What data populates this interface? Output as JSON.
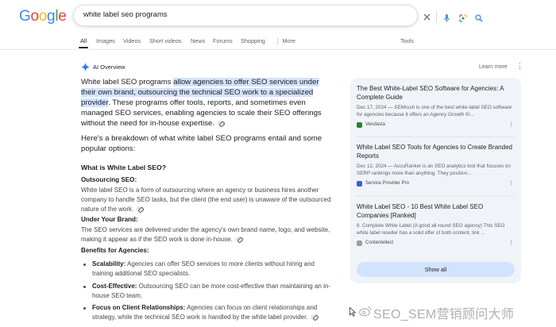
{
  "logo": {
    "letters": [
      "G",
      "o",
      "o",
      "g",
      "l",
      "e"
    ],
    "colors": [
      "#4285f4",
      "#ea4335",
      "#fbbc05",
      "#4285f4",
      "#34a853",
      "#ea4335"
    ]
  },
  "search": {
    "query": "white label seo programs"
  },
  "tabs": [
    "All",
    "Images",
    "Videos",
    "Short videos",
    "News",
    "Forums",
    "Shopping",
    "⋮ More",
    "Tools"
  ],
  "ai_overview": {
    "label": "AI Overview",
    "learn_more": "Learn more",
    "intro_plain_1": "White label SEO programs ",
    "intro_highlight": "allow agencies to offer SEO services under their own brand, outsourcing the technical SEO work to a specialized provider",
    "intro_plain_2": ". These programs offer tools, reports, and sometimes even managed SEO services, enabling agencies to scale their SEO offerings without the need for in-house expertise.",
    "breakdown": "Here's a breakdown of what white label SEO programs entail and some popular options:",
    "h_what": "What is White Label SEO?",
    "h_outsourcing": "Outsourcing SEO:",
    "p_outsourcing": "White label SEO is a form of outsourcing where an agency or business hires another company to handle SEO tasks, but the client (the end user) is unaware of the outsourced nature of the work.",
    "h_brand": "Under Your Brand:",
    "p_brand": "The SEO services are delivered under the agency's own brand name, logo, and website, making it appear as if the SEO work is done in-house.",
    "h_benefits": "Benefits for Agencies:",
    "benefits": [
      {
        "title": "Scalability:",
        "text": " Agencies can offer SEO services to more clients without hiring and training additional SEO specialists."
      },
      {
        "title": "Cost-Effective:",
        "text": " Outsourcing SEO can be more cost-effective than maintaining an in-house SEO team."
      },
      {
        "title": "Focus on Client Relationships:",
        "text": " Agencies can focus on client relationships and strategy, while the technical SEO work is handled by the white label provider."
      }
    ]
  },
  "sources": [
    {
      "title": "The Best White-Label SEO Software for Agencies: A Complete Guide",
      "meta": "Dec 17, 2024 — SEMrush is one of the best white-label SEO software for agencies because it offers an Agency Growth Ki...",
      "site": "Vendasta",
      "color": "#2e7d32"
    },
    {
      "title": "White Label SEO Tools for Agencies to Create Branded Reports",
      "meta": "Dec 12, 2024 — AccuRanker is an SEO analytics tool that focuses on SERP rankings more than anything. They position...",
      "site": "Service Provider Pro",
      "color": "#3b5bdb"
    },
    {
      "title": "White Label SEO - 10 Best White Label SEO Companies [Ranked]",
      "meta": "8. Complete White Label (A good all-round SEO agency) This SEO white label reseller has a solid offer of both content, link ...",
      "site": "Contentellect",
      "color": "#9e9e9e"
    }
  ],
  "show_all": "Show all",
  "watermark": "SEO_SEM营销顾问大师"
}
